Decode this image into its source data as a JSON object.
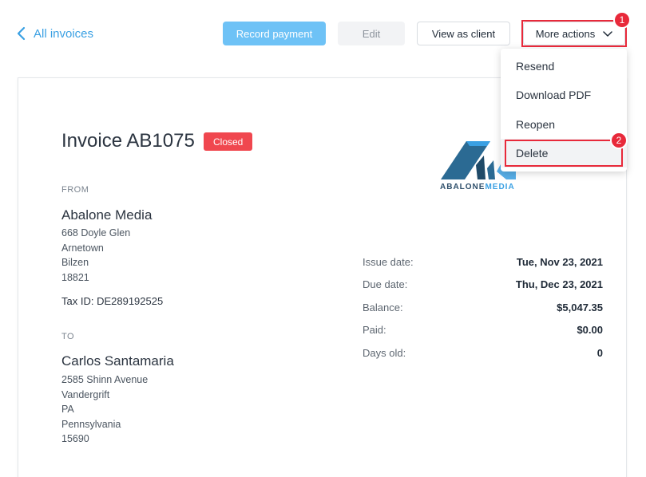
{
  "header": {
    "back_label": "All invoices",
    "record_payment": "Record payment",
    "edit": "Edit",
    "view_as_client": "View as client",
    "more_actions": "More actions"
  },
  "markers": [
    "1",
    "2"
  ],
  "dropdown": {
    "items": [
      {
        "label": "Resend"
      },
      {
        "label": "Download PDF"
      },
      {
        "label": "Reopen"
      },
      {
        "label": "Delete"
      }
    ]
  },
  "invoice": {
    "title": "Invoice AB1075",
    "status": "Closed",
    "status_color": "#f0474f",
    "from_label": "FROM",
    "from": {
      "name": "Abalone Media",
      "address": [
        "668 Doyle Glen",
        "Arnetown",
        "Bilzen",
        "18821"
      ],
      "tax_id": "Tax ID: DE289192525"
    },
    "to_label": "TO",
    "to": {
      "name": "Carlos Santamaria",
      "address": [
        "2585 Shinn Avenue",
        "Vandergrift",
        "PA",
        "Pennsylvania",
        "15690"
      ]
    },
    "logo": {
      "word1": "ABALONE",
      "word2": "MEDIA"
    },
    "details": [
      {
        "label": "Issue date:",
        "value": "Tue, Nov 23, 2021"
      },
      {
        "label": "Due date:",
        "value": "Thu, Dec 23, 2021"
      },
      {
        "label": "Balance:",
        "value": "$5,047.35"
      },
      {
        "label": "Paid:",
        "value": "$0.00"
      },
      {
        "label": "Days old:",
        "value": "0"
      }
    ]
  },
  "colors": {
    "accent": "#3aa0e3",
    "highlight": "#e8293a"
  }
}
